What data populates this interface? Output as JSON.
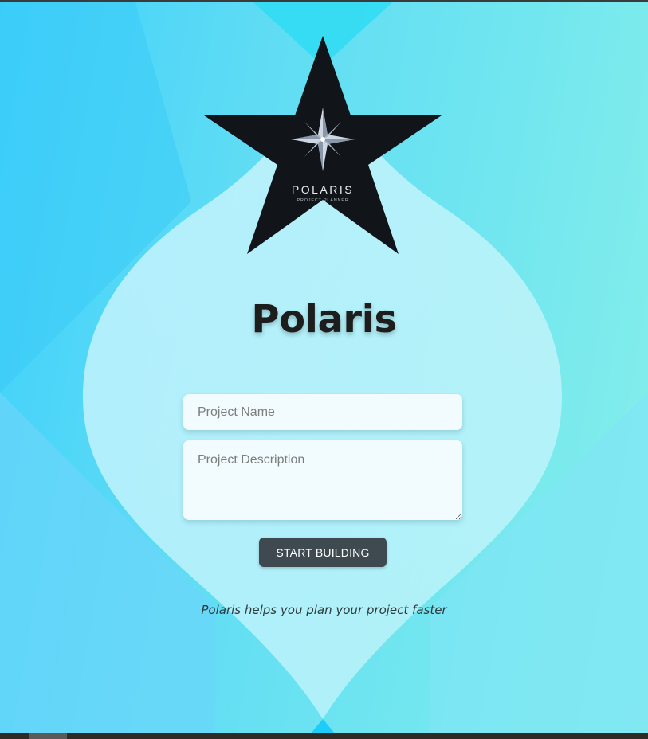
{
  "logo": {
    "wordmark": "POLARIS",
    "subtitle": "PROJECT PLANNER",
    "icon": "compass-star-icon"
  },
  "header": {
    "title": "Polaris"
  },
  "form": {
    "name_placeholder": "Project Name",
    "description_placeholder": "Project Description",
    "submit_label": "START BUILDING"
  },
  "footer": {
    "tagline": "Polaris helps you plan your project faster"
  },
  "colors": {
    "background_start": "#3fd0fb",
    "background_end": "#86efe9",
    "button": "#3e4a4f",
    "star": "#111418"
  }
}
